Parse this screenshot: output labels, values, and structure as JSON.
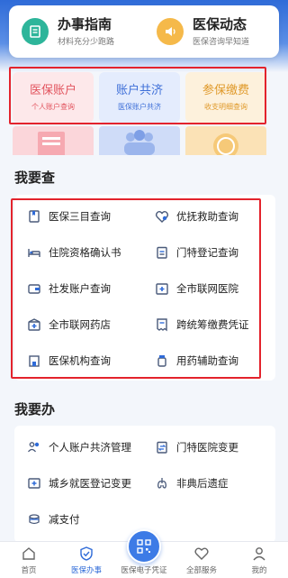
{
  "guides": [
    {
      "title": "办事指南",
      "subtitle": "材料充分少跑路",
      "icon": "book-icon"
    },
    {
      "title": "医保动态",
      "subtitle": "医保咨询早知道",
      "icon": "speaker-icon"
    }
  ],
  "accounts": [
    {
      "title": "医保账户",
      "subtitle": "个人账户查询"
    },
    {
      "title": "账户共济",
      "subtitle": "医保账户共济"
    },
    {
      "title": "参保缴费",
      "subtitle": "收支明细查询"
    }
  ],
  "query_section": {
    "title": "我要查",
    "items": [
      {
        "label": "医保三目查询",
        "icon": "bookmark-icon"
      },
      {
        "label": "优抚救助查询",
        "icon": "heart-shield-icon"
      },
      {
        "label": "住院资格确认书",
        "icon": "bed-icon"
      },
      {
        "label": "门特登记查询",
        "icon": "clipboard-icon"
      },
      {
        "label": "社发账户查询",
        "icon": "wallet-icon"
      },
      {
        "label": "全市联网医院",
        "icon": "hospital-icon"
      },
      {
        "label": "全市联网药店",
        "icon": "pharmacy-icon"
      },
      {
        "label": "跨统筹缴费凭证",
        "icon": "receipt-icon"
      },
      {
        "label": "医保机构查询",
        "icon": "building-icon"
      },
      {
        "label": "用药辅助查询",
        "icon": "medicine-icon"
      }
    ]
  },
  "do_section": {
    "title": "我要办",
    "items": [
      {
        "label": "个人账户共济管理",
        "icon": "people-icon"
      },
      {
        "label": "门特医院变更",
        "icon": "transfer-icon"
      },
      {
        "label": "城乡就医登记变更",
        "icon": "register-icon"
      },
      {
        "label": "非典后遗症",
        "icon": "lungs-icon"
      },
      {
        "label": "减支付",
        "icon": "coin-icon"
      }
    ]
  },
  "nav": [
    {
      "label": "首页",
      "icon": "home-icon"
    },
    {
      "label": "医保办事",
      "icon": "shield-icon",
      "active": true
    },
    {
      "label": "医保电子凭证",
      "icon": "qr-icon"
    },
    {
      "label": "全部服务",
      "icon": "heart-icon"
    },
    {
      "label": "我的",
      "icon": "user-icon"
    }
  ],
  "colors": {
    "accent": "#2f6bd8",
    "highlight_box": "#e3232c"
  }
}
